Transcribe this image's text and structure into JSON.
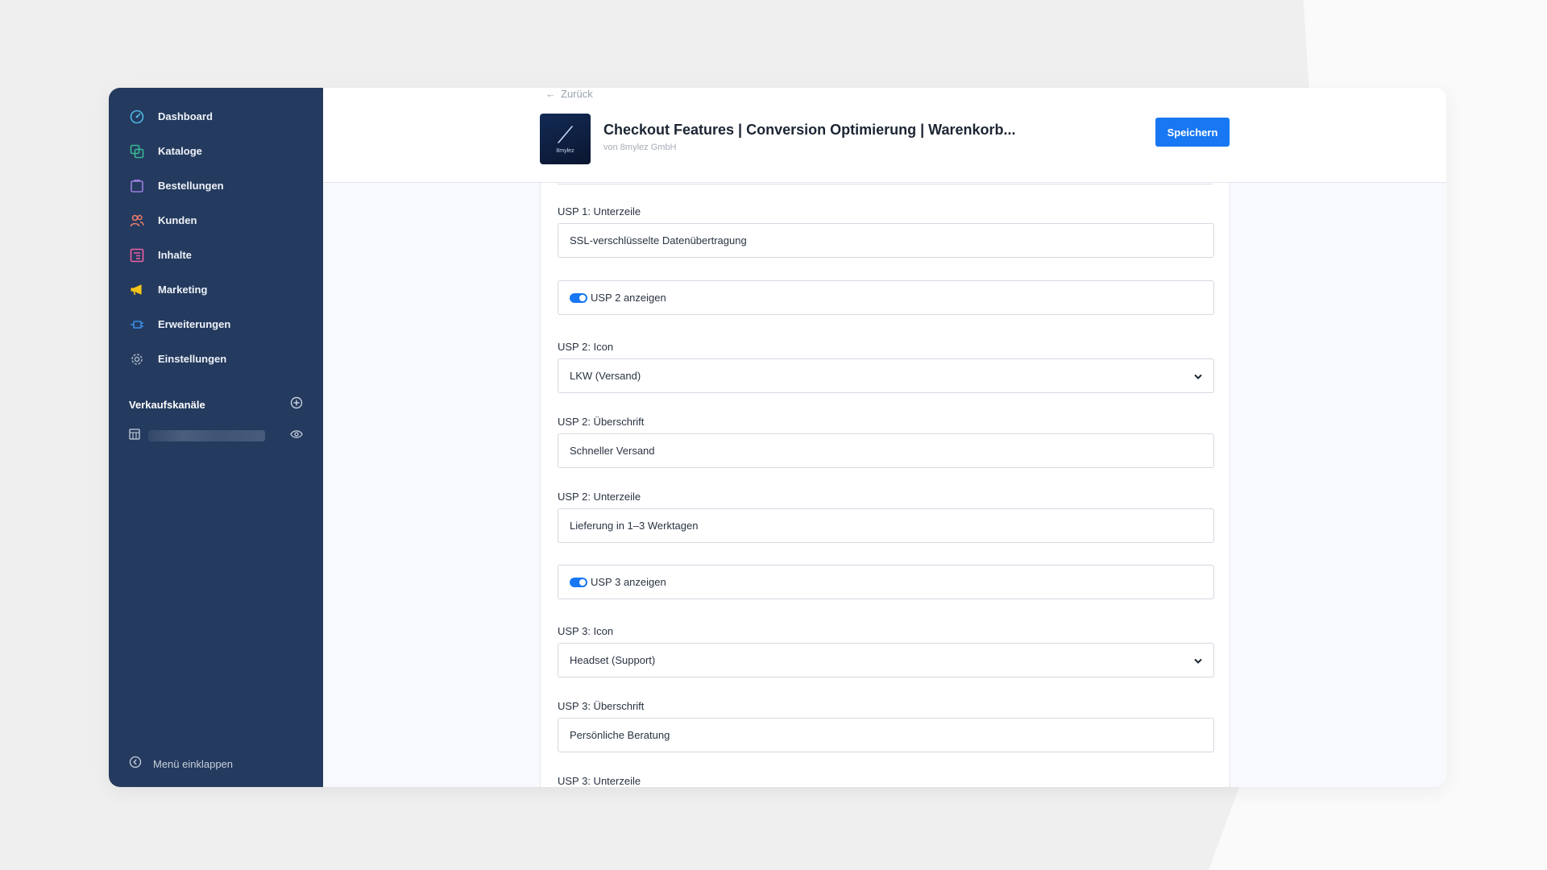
{
  "sidebar": {
    "items": [
      {
        "label": "Dashboard",
        "color": "#4fb6e6"
      },
      {
        "label": "Kataloge",
        "color": "#37b894"
      },
      {
        "label": "Bestellungen",
        "color": "#9a7fe0"
      },
      {
        "label": "Kunden",
        "color": "#f07a6a"
      },
      {
        "label": "Inhalte",
        "color": "#f05fa5"
      },
      {
        "label": "Marketing",
        "color": "#f5c518"
      },
      {
        "label": "Erweiterungen",
        "color": "#3a8fe8"
      },
      {
        "label": "Einstellungen",
        "color": "#a7b3c6"
      }
    ],
    "sales_channels_label": "Verkaufskanäle",
    "collapse_label": "Menü einklappen"
  },
  "header": {
    "back_label": "Zurück",
    "app_title": "Checkout Features | Conversion Optimierung | Warenkorb...",
    "app_vendor": "von 8mylez GmbH",
    "logo_text": "8mylez",
    "save_label": "Speichern"
  },
  "form": {
    "usp1_subline_label": "USP 1: Unterzeile",
    "usp1_subline_value": "SSL-verschlüsselte Datenübertragung",
    "usp2_show_label": "USP 2 anzeigen",
    "usp2_icon_label": "USP 2: Icon",
    "usp2_icon_value": "LKW (Versand)",
    "usp2_heading_label": "USP 2: Überschrift",
    "usp2_heading_value": "Schneller Versand",
    "usp2_subline_label": "USP 2: Unterzeile",
    "usp2_subline_value": "Lieferung in 1–3 Werktagen",
    "usp3_show_label": "USP 3 anzeigen",
    "usp3_icon_label": "USP 3: Icon",
    "usp3_icon_value": "Headset (Support)",
    "usp3_heading_label": "USP 3: Überschrift",
    "usp3_heading_value": "Persönliche Beratung",
    "usp3_subline_label": "USP 3: Unterzeile"
  },
  "colors": {
    "sidebar_bg": "#243a5e",
    "accent": "#1877f2"
  }
}
